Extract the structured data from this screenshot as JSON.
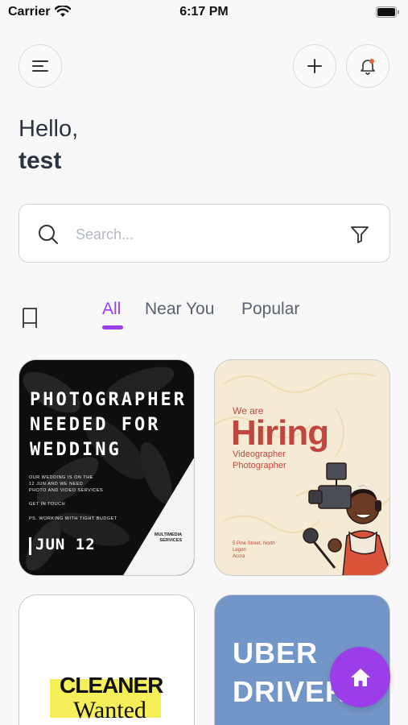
{
  "status_bar": {
    "carrier": "Carrier",
    "time": "6:17 PM"
  },
  "header": {
    "menu_icon": "menu-icon",
    "add_icon": "plus-icon",
    "bell_icon": "bell-icon",
    "notification_dot_color": "#e8643c"
  },
  "greeting": {
    "hello": "Hello,",
    "username": "test"
  },
  "search": {
    "placeholder": "Search...",
    "value": ""
  },
  "tabs": [
    {
      "label": "All",
      "active": true
    },
    {
      "label": "Near You",
      "active": false
    },
    {
      "label": "Popular",
      "active": false
    }
  ],
  "accent_color": "#9b3de8",
  "cards": [
    {
      "title": "PHOTOGRAPHER\nNEEDED FOR\nWEDDING",
      "body": "OUR WEDDING IS ON THE\n12 JUN       AND WE NEED\nPHOTO AND VIDEO SERVICES",
      "contact": "GET IN TOUCH",
      "note": "PS. WORKING WITH TIGHT BUDGET",
      "date": "JUN 12",
      "services": "MULTIMEDIA\nSERVICES"
    },
    {
      "intro": "We are",
      "title": "Hiring",
      "roles": "Videographer\nPhotographer",
      "address": "5 Pine Street, North Legon\nAccra"
    },
    {
      "title": "CLEANER",
      "subtitle": "Wanted"
    },
    {
      "title": "UBER\nDRIVER"
    }
  ],
  "fab": {
    "icon": "home-icon"
  }
}
